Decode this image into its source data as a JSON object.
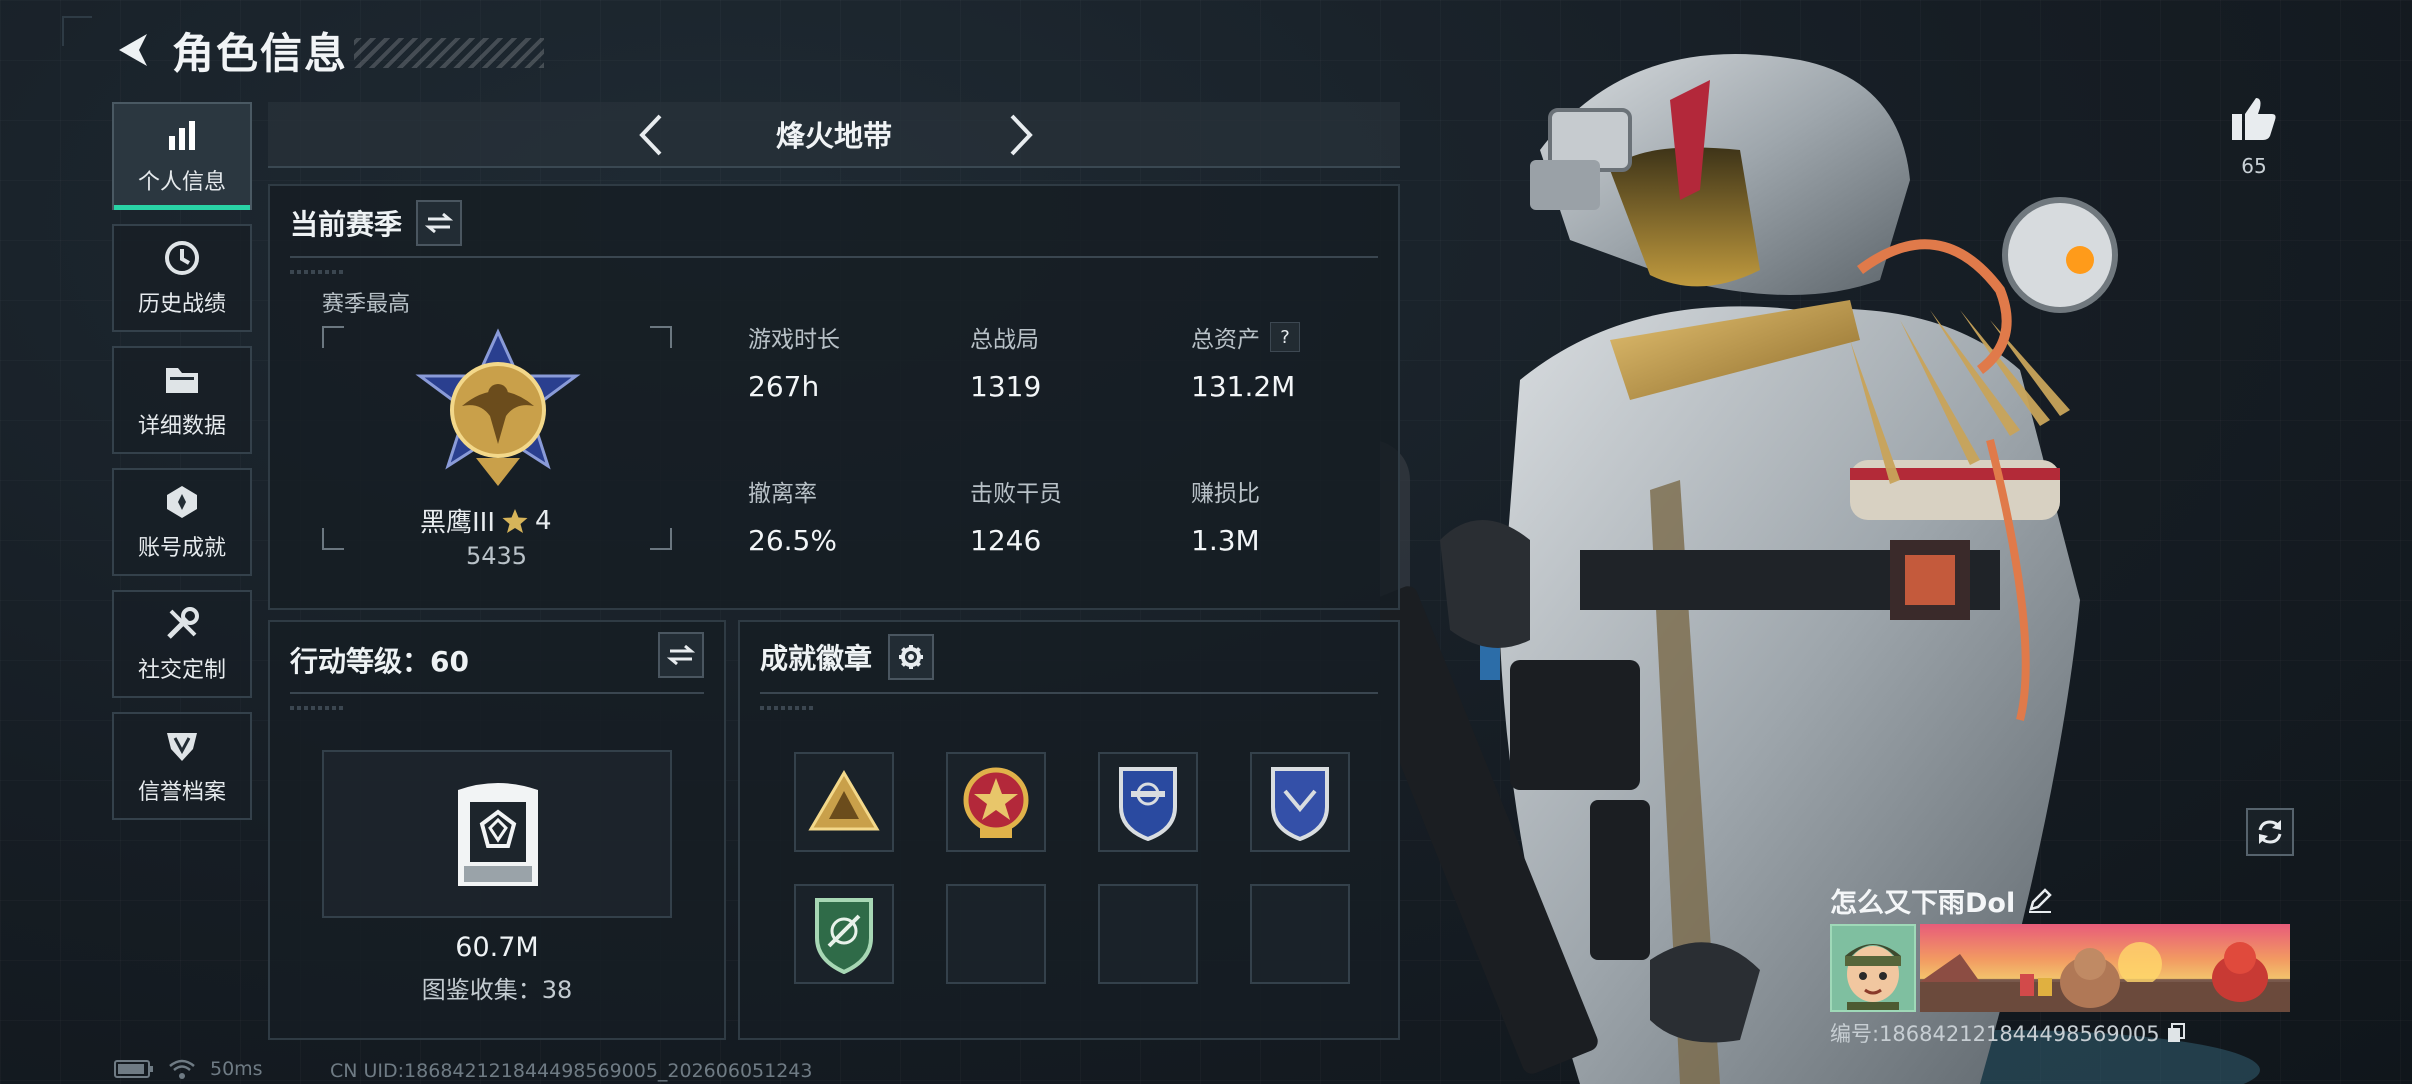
{
  "header": {
    "title": "角色信息"
  },
  "sidebar": {
    "items": [
      {
        "label": "个人信息",
        "icon": "bar-chart-icon",
        "active": true
      },
      {
        "label": "历史战绩",
        "icon": "clock-history-icon",
        "active": false
      },
      {
        "label": "详细数据",
        "icon": "folder-icon",
        "active": false
      },
      {
        "label": "账号成就",
        "icon": "achievement-icon",
        "active": false
      },
      {
        "label": "社交定制",
        "icon": "tools-icon",
        "active": false
      },
      {
        "label": "信誉档案",
        "icon": "shield-v-icon",
        "active": false
      }
    ]
  },
  "mode": {
    "title": "烽火地带"
  },
  "season": {
    "title": "当前赛季",
    "subtitle": "赛季最高",
    "rank_name": "黑鹰III",
    "rank_stars": "4",
    "rank_score": "5435",
    "stats": [
      {
        "label": "游戏时长",
        "value": "267h"
      },
      {
        "label": "总战局",
        "value": "1319"
      },
      {
        "label": "总资产",
        "value": "131.2M",
        "help": "?"
      },
      {
        "label": "撤离率",
        "value": "26.5%"
      },
      {
        "label": "击败干员",
        "value": "1246"
      },
      {
        "label": "赚损比",
        "value": "1.3M"
      }
    ]
  },
  "action_level": {
    "title": "行动等级：60",
    "value": "60.7M",
    "collection_label": "图鉴收集：38"
  },
  "badges": {
    "title": "成就徽章",
    "slots": [
      "triangle-badge",
      "star-medal-badge",
      "blue-shield-badge",
      "blue-shield-badge-2",
      "green-shield-badge",
      "",
      "",
      ""
    ]
  },
  "likes": {
    "count": "65"
  },
  "player": {
    "name": "怎么又下雨Dol",
    "id_text": "编号:186842121844498569005"
  },
  "footer": {
    "ping": "50ms",
    "uid": "CN UID:186842121844498569005_202606051243"
  },
  "colors": {
    "accent": "#29d3a6",
    "panel_border": "#2f3b44",
    "background": "#161d24"
  }
}
